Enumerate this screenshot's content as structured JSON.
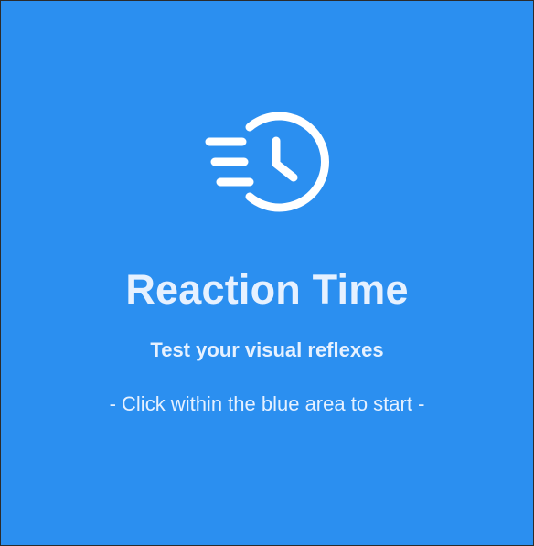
{
  "app": {
    "title": "Reaction Time",
    "subtitle": "Test your visual reflexes",
    "instruction": "- Click within the blue area to start -",
    "icon": "stopwatch-speed-icon"
  },
  "colors": {
    "background": "#2b8ff0",
    "text": "#e6f1ff",
    "icon": "#ffffff"
  }
}
